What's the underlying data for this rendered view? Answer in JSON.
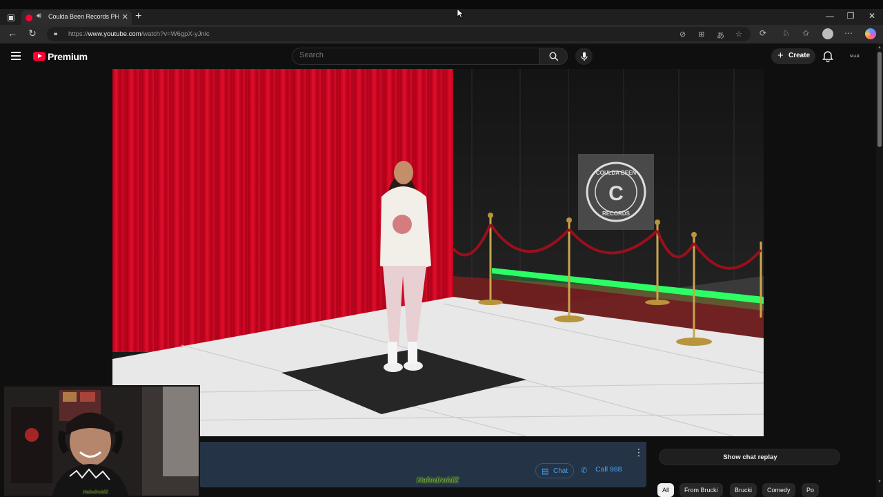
{
  "browser": {
    "tab_title": "Coulda Been Records PHILAD",
    "new_tab": "+",
    "url_prefix": "https://",
    "url_host": "www.youtube.com",
    "url_path": "/watch?v=W6gpX-yJnlc",
    "window_controls": [
      "—",
      "❐",
      "✕"
    ]
  },
  "youtube": {
    "logo_text": "Premium",
    "search_placeholder": "Search",
    "create_label": "Create",
    "avatar_text": "MAR"
  },
  "video": {
    "backdrop_logo_lines": [
      "COULDA BEEN",
      "C",
      "RECORDS"
    ]
  },
  "stream_banner": {
    "chat_label": "Chat",
    "call_label": "Call 988",
    "kebab": "⋮"
  },
  "watermark": "HalodroidZ",
  "webcam_label": "HalodroidZ",
  "chat": {
    "show_replay_label": "Show chat replay"
  },
  "chips": [
    "All",
    "From Brucki",
    "Brucki",
    "Comedy",
    "Po"
  ],
  "colors": {
    "youtube_red": "#ff0033",
    "link_blue": "#3ea6ff",
    "banner_bg": "#243446",
    "neon_green": "#3dff6a"
  }
}
